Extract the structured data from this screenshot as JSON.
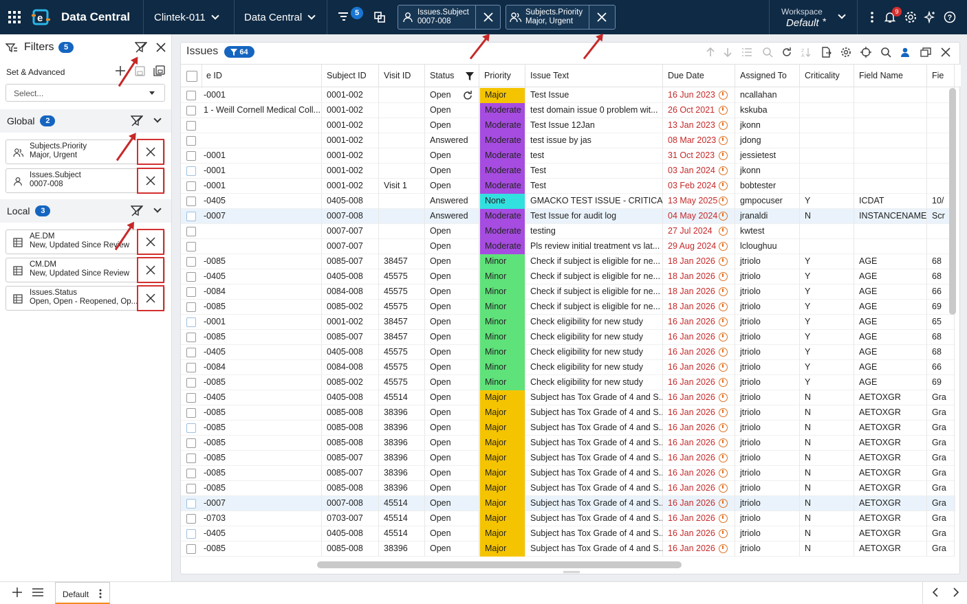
{
  "app": {
    "title": "Data Central",
    "study": "Clintek-011",
    "module": "Data Central",
    "filter_count": "5",
    "notifications": "9"
  },
  "chips": [
    {
      "field": "Issues.Subject",
      "value": "0007-008"
    },
    {
      "field": "Subjects.Priority",
      "value": "Major, Urgent"
    }
  ],
  "workspace": {
    "label": "Workspace",
    "value": "Default",
    "star": "*"
  },
  "filters": {
    "title": "Filters",
    "count": "5",
    "set_label": "Set & Advanced",
    "select_placeholder": "Select...",
    "global": {
      "label": "Global",
      "count": "2",
      "items": [
        {
          "field": "Subjects.Priority",
          "value": "Major, Urgent",
          "icon": "users-icon"
        },
        {
          "field": "Issues.Subject",
          "value": "0007-008",
          "icon": "user-icon"
        }
      ]
    },
    "local": {
      "label": "Local",
      "count": "3",
      "items": [
        {
          "field": "AE.DM",
          "value": "New, Updated Since Review",
          "icon": "table-icon"
        },
        {
          "field": "CM.DM",
          "value": "New, Updated Since Review",
          "icon": "table-icon"
        },
        {
          "field": "Issues.Status",
          "value": "Open, Open - Reopened, Op...",
          "icon": "table-icon"
        }
      ]
    }
  },
  "issues": {
    "title": "Issues",
    "count": "64",
    "columns": [
      "e ID",
      "Subject ID",
      "Visit ID",
      "Status",
      "Priority",
      "Issue Text",
      "Due Date",
      "Assigned To",
      "Criticality",
      "Field Name",
      "Fie"
    ],
    "priority_colors": {
      "Major": "#f5c400",
      "Moderate": "#a64ce0",
      "None": "#33e0e0",
      "Minor": "#5fe27a"
    },
    "rows": [
      [
        "-0001",
        "0001-002",
        "",
        "Open",
        "Major",
        "Test Issue",
        "16 Jun 2023",
        "ncallahan",
        "",
        "",
        ""
      ],
      [
        "1 - Weill Cornell Medical Coll...",
        "0001-002",
        "",
        "Open",
        "Moderate",
        "test domain issue 0 problem wit...",
        "26 Oct 2021",
        "kskuba",
        "",
        "",
        ""
      ],
      [
        "",
        "0001-002",
        "",
        "Open",
        "Moderate",
        "Test Issue 12Jan",
        "13 Jan 2023",
        "jkonn",
        "",
        "",
        ""
      ],
      [
        "",
        "0001-002",
        "",
        "Answered",
        "Moderate",
        "test issue by jas",
        "08 Mar 2023",
        "jdong",
        "",
        "",
        ""
      ],
      [
        "-0001",
        "0001-002",
        "",
        "Open",
        "Moderate",
        "test",
        "31 Oct 2023",
        "jessietest",
        "",
        "",
        ""
      ],
      [
        "-0001",
        "0001-002",
        "",
        "Open",
        "Moderate",
        "Test",
        "03 Jan 2024",
        "jkonn",
        "",
        "",
        ""
      ],
      [
        "-0001",
        "0001-002",
        "Visit 1",
        "Open",
        "Moderate",
        "Test",
        "03 Feb 2024",
        "bobtester",
        "",
        "",
        ""
      ],
      [
        "-0405",
        "0405-008",
        "",
        "Answered",
        "None",
        "GMACKO TEST ISSUE - CRITICAL",
        "13 May 2025",
        "gmpocuser",
        "Y",
        "ICDAT",
        "10/"
      ],
      [
        "-0007",
        "0007-008",
        "",
        "Answered",
        "Moderate",
        "Test Issue for audit log",
        "04 May 2024",
        "jranaldi",
        "N",
        "INSTANCENAME",
        "Scr"
      ],
      [
        "",
        "0007-007",
        "",
        "Open",
        "Moderate",
        "testing",
        "27 Jul 2024",
        "kwtest",
        "",
        "",
        ""
      ],
      [
        "",
        "0007-007",
        "",
        "Open",
        "Moderate",
        "Pls review initial treatment vs lat...",
        "29 Aug 2024",
        "lcloughuu",
        "",
        "",
        ""
      ],
      [
        "-0085",
        "0085-007",
        "38457",
        "Open",
        "Minor",
        "Check if subject is eligible for ne...",
        "18 Jan 2026",
        "jtriolo",
        "Y",
        "AGE",
        "68"
      ],
      [
        "-0405",
        "0405-008",
        "45575",
        "Open",
        "Minor",
        "Check if subject is eligible for ne...",
        "18 Jan 2026",
        "jtriolo",
        "Y",
        "AGE",
        "68"
      ],
      [
        "-0084",
        "0084-008",
        "45575",
        "Open",
        "Minor",
        "Check if subject is eligible for ne...",
        "18 Jan 2026",
        "jtriolo",
        "Y",
        "AGE",
        "66"
      ],
      [
        "-0085",
        "0085-002",
        "45575",
        "Open",
        "Minor",
        "Check if subject is eligible for ne...",
        "18 Jan 2026",
        "jtriolo",
        "Y",
        "AGE",
        "69"
      ],
      [
        "-0001",
        "0001-002",
        "38457",
        "Open",
        "Minor",
        "Check eligibility for new study",
        "16 Jan 2026",
        "jtriolo",
        "Y",
        "AGE",
        "65"
      ],
      [
        "-0085",
        "0085-007",
        "38457",
        "Open",
        "Minor",
        "Check eligibility for new study",
        "16 Jan 2026",
        "jtriolo",
        "Y",
        "AGE",
        "68"
      ],
      [
        "-0405",
        "0405-008",
        "45575",
        "Open",
        "Minor",
        "Check eligibility for new study",
        "16 Jan 2026",
        "jtriolo",
        "Y",
        "AGE",
        "68"
      ],
      [
        "-0084",
        "0084-008",
        "45575",
        "Open",
        "Minor",
        "Check eligibility for new study",
        "16 Jan 2026",
        "jtriolo",
        "Y",
        "AGE",
        "66"
      ],
      [
        "-0085",
        "0085-002",
        "45575",
        "Open",
        "Minor",
        "Check eligibility for new study",
        "16 Jan 2026",
        "jtriolo",
        "Y",
        "AGE",
        "69"
      ],
      [
        "-0405",
        "0405-008",
        "45514",
        "Open",
        "Major",
        "Subject has Tox Grade of 4 and S...",
        "16 Jan 2026",
        "jtriolo",
        "N",
        "AETOXGR",
        "Gra"
      ],
      [
        "-0085",
        "0085-008",
        "38396",
        "Open",
        "Major",
        "Subject has Tox Grade of 4 and S...",
        "16 Jan 2026",
        "jtriolo",
        "N",
        "AETOXGR",
        "Gra"
      ],
      [
        "-0085",
        "0085-008",
        "38396",
        "Open",
        "Major",
        "Subject has Tox Grade of 4 and S...",
        "16 Jan 2026",
        "jtriolo",
        "N",
        "AETOXGR",
        "Gra"
      ],
      [
        "-0085",
        "0085-008",
        "38396",
        "Open",
        "Major",
        "Subject has Tox Grade of 4 and S...",
        "16 Jan 2026",
        "jtriolo",
        "N",
        "AETOXGR",
        "Gra"
      ],
      [
        "-0085",
        "0085-007",
        "38396",
        "Open",
        "Major",
        "Subject has Tox Grade of 4 and S...",
        "16 Jan 2026",
        "jtriolo",
        "N",
        "AETOXGR",
        "Gra"
      ],
      [
        "-0085",
        "0085-007",
        "38396",
        "Open",
        "Major",
        "Subject has Tox Grade of 4 and S...",
        "16 Jan 2026",
        "jtriolo",
        "N",
        "AETOXGR",
        "Gra"
      ],
      [
        "-0085",
        "0085-008",
        "38396",
        "Open",
        "Major",
        "Subject has Tox Grade of 4 and S...",
        "16 Jan 2026",
        "jtriolo",
        "N",
        "AETOXGR",
        "Gra"
      ],
      [
        "-0007",
        "0007-008",
        "45514",
        "Open",
        "Major",
        "Subject has Tox Grade of 4 and S...",
        "16 Jan 2026",
        "jtriolo",
        "N",
        "AETOXGR",
        "Gra"
      ],
      [
        "-0703",
        "0703-007",
        "45514",
        "Open",
        "Major",
        "Subject has Tox Grade of 4 and S...",
        "16 Jan 2026",
        "jtriolo",
        "N",
        "AETOXGR",
        "Gra"
      ],
      [
        "-0405",
        "0405-008",
        "45514",
        "Open",
        "Major",
        "Subject has Tox Grade of 4 and S...",
        "16 Jan 2026",
        "jtriolo",
        "N",
        "AETOXGR",
        "Gra"
      ],
      [
        "-0085",
        "0085-008",
        "38396",
        "Open",
        "Major",
        "Subject has Tox Grade of 4 and S...",
        "16 Jan 2026",
        "jtriolo",
        "N",
        "AETOXGR",
        "Gra"
      ]
    ]
  },
  "footer": {
    "tab": "Default"
  }
}
